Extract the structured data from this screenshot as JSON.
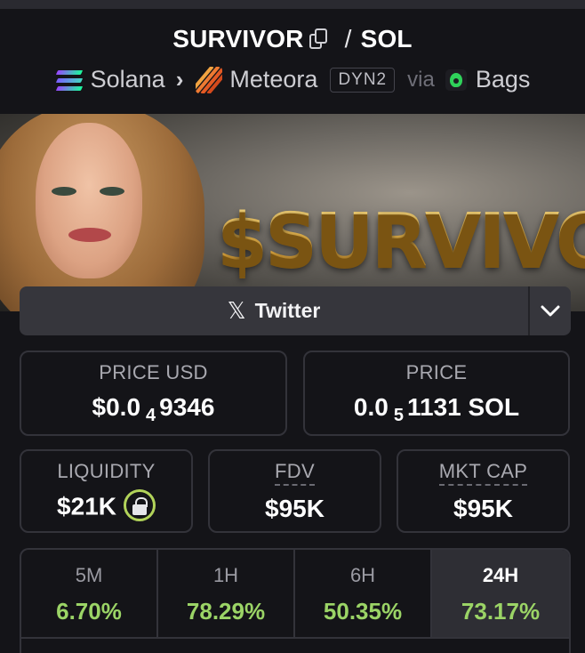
{
  "header": {
    "token_symbol": "SURVIVOR",
    "separator": "/",
    "quote_symbol": "SOL",
    "chain": "Solana",
    "dex": "Meteora",
    "pool_badge": "DYN2",
    "via_label": "via",
    "launchpad": "Bags"
  },
  "banner": {
    "ticker_text": "$SURVIVOR"
  },
  "social": {
    "twitter_label": "Twitter",
    "x_glyph": "𝕏"
  },
  "stats": {
    "price_usd": {
      "label": "PRICE USD",
      "prefix": "$0.0",
      "zeros": "4",
      "digits": "9346"
    },
    "price_native": {
      "label": "PRICE",
      "prefix": "0.0",
      "zeros": "5",
      "digits": "1131 SOL"
    },
    "liquidity": {
      "label": "LIQUIDITY",
      "value": "$21K"
    },
    "fdv": {
      "label": "FDV",
      "value": "$95K"
    },
    "mkt_cap": {
      "label": "MKT CAP",
      "value": "$95K"
    }
  },
  "periods": [
    {
      "label": "5M",
      "change": "6.70%"
    },
    {
      "label": "1H",
      "change": "78.29%"
    },
    {
      "label": "6H",
      "change": "50.35%"
    },
    {
      "label": "24H",
      "change": "73.17%"
    }
  ],
  "active_period": "24H",
  "colors": {
    "positive": "#9bd466",
    "lock_ring": "#b2d35a",
    "background": "#141418"
  }
}
